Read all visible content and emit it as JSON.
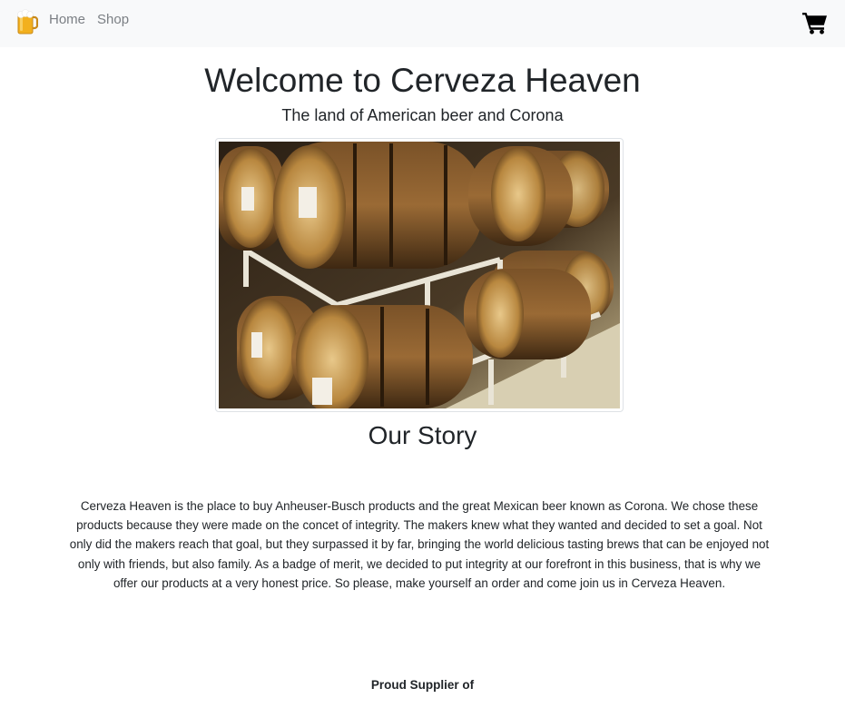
{
  "navbar": {
    "logo_icon": "beer-mug-icon",
    "links": [
      {
        "label": "Home"
      },
      {
        "label": "Shop"
      }
    ],
    "cart_icon": "shopping-cart-icon"
  },
  "hero": {
    "title": "Welcome to Cerveza Heaven",
    "subtitle": "The land of American beer and Corona",
    "image_subject": "wooden-beer-barrels-on-racks"
  },
  "story": {
    "heading": "Our Story",
    "body": "Cerveza Heaven is the place to buy Anheuser-Busch products and the great Mexican beer known as Corona. We chose these products because they were made on the concet of integrity. The makers knew what they wanted and decided to set a goal. Not only did the makers reach that goal, but they surpassed it by far, bringing the world delicious tasting brews that can be enjoyed not only with friends, but also family. As a badge of merit, we decided to put integrity at our forefront in this business, that is why we offer our products at a very honest price. So please, make yourself an order and come join us in Cerveza Heaven."
  },
  "suppliers": {
    "heading": "Proud Supplier of"
  },
  "colors": {
    "navbar_bg": "#f8f9fa",
    "nav_link": "#7b7f84",
    "text": "#212529",
    "image_border": "#dee2e6"
  }
}
